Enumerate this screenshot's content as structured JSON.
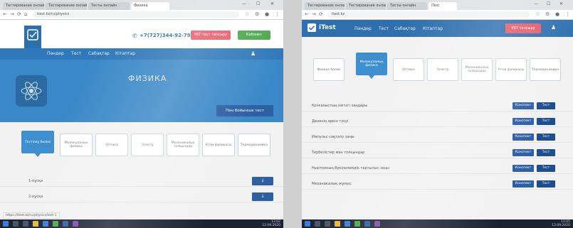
{
  "left": {
    "tabs": [
      "Тестирование онлайн",
      "Тестирование онлайн",
      "Тесты онлайн",
      "Физика"
    ],
    "url": "itest.kz/ru/physics",
    "phone": "+7(727)344-92-79",
    "red_button": "ҰБТ тест тапсыру",
    "green_button": "Кабинет",
    "nav": [
      "Пәндер",
      "Тест",
      "Сабақтар",
      "Кітаптар"
    ],
    "subject_title": "ФИЗИКА",
    "test_button": "Пән бойынша тест",
    "categories": [
      "Тестілеу бөлімі",
      "Молекулалық физика",
      "Оптика",
      "Электр",
      "Механикалық толқындар",
      "Атом физикасы",
      "Термодинамика"
    ],
    "rows": [
      {
        "label": "1-нұсқа",
        "button": "↓"
      },
      {
        "label": "2-нұсқа",
        "button": "↓"
      }
    ],
    "status_url": "https://itest.kz/ru/physics/test-1",
    "clock": {
      "time": "13:02",
      "date": "12.09.2020"
    }
  },
  "right": {
    "tabs": [
      "Тестирование онлайн",
      "Тестирование онлайн",
      "Тесты онлайн",
      "iTest"
    ],
    "url": "itest.kz",
    "logo": "iTest",
    "nav": [
      "Пәндер",
      "Тест",
      "Сабақтар",
      "Кітаптар"
    ],
    "red_button": "ҰБТ тапсыру",
    "categories": [
      "Физика бөлімі",
      "Молекулалық физика",
      "Оптика",
      "Электр",
      "Механикалық толқындар",
      "Атом физикасы",
      "Термодинамика"
    ],
    "rows": [
      {
        "label": "Қозғалыстың негізгі заңдары",
        "b1": "Конспект",
        "b2": "Тест"
      },
      {
        "label": "Дененің еркін түсуі",
        "b1": "Конспект",
        "b2": "Тест"
      },
      {
        "label": "Импульс сақталу заңы",
        "b1": "Конспект",
        "b2": "Тест"
      },
      {
        "label": "Тербелістер мен толқындар",
        "b1": "Конспект",
        "b2": "Тест"
      },
      {
        "label": "Ньютонның бүкіләлемдік тартылыс заңы",
        "b1": "Конспект",
        "b2": "Тест"
      },
      {
        "label": "Механикалық жұмыс",
        "b1": "Конспект",
        "b2": "Тест"
      }
    ],
    "clock": {
      "time": "13:05",
      "date": "12.09.2020"
    }
  },
  "colors": {
    "primary_blue": "#2f78b9",
    "hero_blue": "#3a88c8",
    "button_navy": "#2d5fa3",
    "accent_red": "#e85a6b",
    "accent_green": "#4aa84a"
  }
}
